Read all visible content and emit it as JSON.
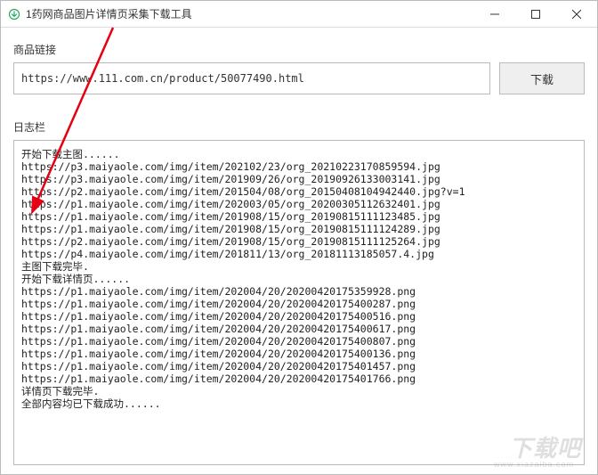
{
  "window": {
    "title": "1药网商品图片详情页采集下载工具"
  },
  "section": {
    "url_label": "商品链接",
    "log_label": "日志栏"
  },
  "input": {
    "url_value": "https://www.111.com.cn/product/50077490.html",
    "url_placeholder": ""
  },
  "buttons": {
    "download": "下载"
  },
  "log": {
    "lines": [
      "开始下载主图......",
      "https://p3.maiyaole.com/img/item/202102/23/org_20210223170859594.jpg",
      "https://p3.maiyaole.com/img/item/201909/26/org_20190926133003141.jpg",
      "https://p2.maiyaole.com/img/item/201504/08/org_20150408104942440.jpg?v=1",
      "https://p1.maiyaole.com/img/item/202003/05/org_20200305112632401.jpg",
      "https://p1.maiyaole.com/img/item/201908/15/org_20190815111123485.jpg",
      "https://p1.maiyaole.com/img/item/201908/15/org_20190815111124289.jpg",
      "https://p2.maiyaole.com/img/item/201908/15/org_20190815111125264.jpg",
      "https://p4.maiyaole.com/img/item/201811/13/org_20181113185057.4.jpg",
      "主图下载完毕.",
      "开始下载详情页......",
      "https://p1.maiyaole.com/img/item/202004/20/20200420175359928.png",
      "https://p1.maiyaole.com/img/item/202004/20/20200420175400287.png",
      "https://p1.maiyaole.com/img/item/202004/20/20200420175400516.png",
      "https://p1.maiyaole.com/img/item/202004/20/20200420175400617.png",
      "https://p1.maiyaole.com/img/item/202004/20/20200420175400807.png",
      "https://p1.maiyaole.com/img/item/202004/20/20200420175400136.png",
      "https://p1.maiyaole.com/img/item/202004/20/20200420175401457.png",
      "https://p1.maiyaole.com/img/item/202004/20/20200420175401766.png",
      "详情页下载完毕.",
      "全部内容均已下载成功......"
    ]
  },
  "watermark": {
    "main": "下载吧",
    "sub": "www.xiazaiba.com"
  }
}
